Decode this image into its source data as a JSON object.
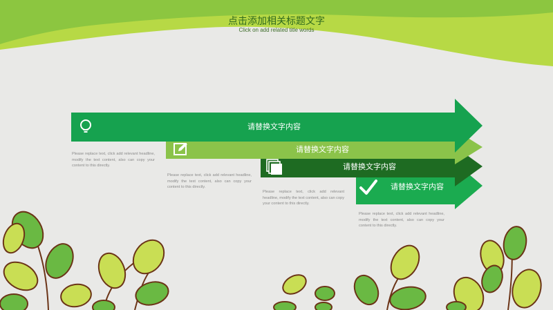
{
  "header": {
    "title": "点击添加相关标题文字",
    "subtitle": "Click on add related title words"
  },
  "colors": {
    "background": "#e9e9e7",
    "top_wave_dark": "#8cc640",
    "top_wave_light": "#b5d948",
    "step1": "#16a24f",
    "step2": "#8bc34a",
    "step3": "#1e6b22",
    "step4": "#1bab50",
    "leaf_fill_green": "#6ab943",
    "leaf_fill_yellow": "#c9de54",
    "leaf_outline": "#6b3417"
  },
  "steps": [
    {
      "label": "请替换文字内容",
      "icon": "lightbulb-icon",
      "description": "Please replace text, click add relevant headline, modify the text content, also can copy your content to this directly."
    },
    {
      "label": "请替换文字内容",
      "icon": "edit-icon",
      "description": "Please replace text, click add relevant headline, modify the text content, also can copy your content to this directly."
    },
    {
      "label": "请替换文字内容",
      "icon": "documents-icon",
      "description": "Please replace text, click add relevant headline, modify the text content, also can copy your content to this directly."
    },
    {
      "label": "请替换文字内容",
      "icon": "checkmark-icon",
      "description": "Please replace text, click add relevant headline, modify the text content, also can copy your content to this directly."
    }
  ]
}
